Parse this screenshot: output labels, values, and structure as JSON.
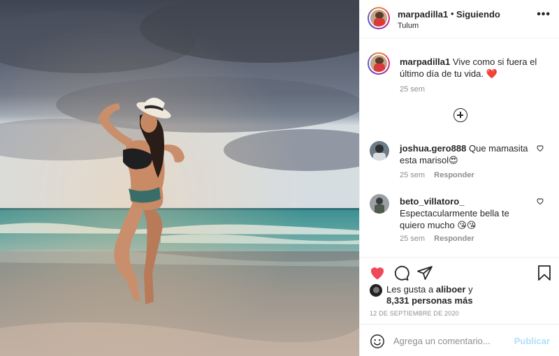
{
  "post": {
    "username": "marpadilla1",
    "separator": "•",
    "follow_status": "Siguiendo",
    "location": "Tulum",
    "more_icon": "more-options-icon"
  },
  "caption": {
    "username": "marpadilla1",
    "text": "Vive como si fuera el último día de tu vida. ❤️",
    "time": "25 sem"
  },
  "load_more_icon": "plus-circle-icon",
  "comments": [
    {
      "username": "joshua.gero888",
      "text": "Que mamasita esta marisol😍",
      "time": "25 sem",
      "reply": "Responder"
    },
    {
      "username": "beto_villatoro_",
      "text": "Espectacularmente bella te quiero mucho 😘😘",
      "time": "25 sem",
      "reply": "Responder"
    }
  ],
  "likes": {
    "prefix": "Les gusta a",
    "user": "aliboer",
    "conj": "y",
    "count": "8,331 personas más"
  },
  "date": "12 DE SEPTIEMBRE DE 2020",
  "add_comment": {
    "placeholder": "Agrega un comentario...",
    "publish": "Publicar"
  },
  "colors": {
    "like_red": "#ed4956",
    "text": "#262626",
    "muted": "#8e8e8e",
    "publish_disabled": "#b2dffc"
  }
}
